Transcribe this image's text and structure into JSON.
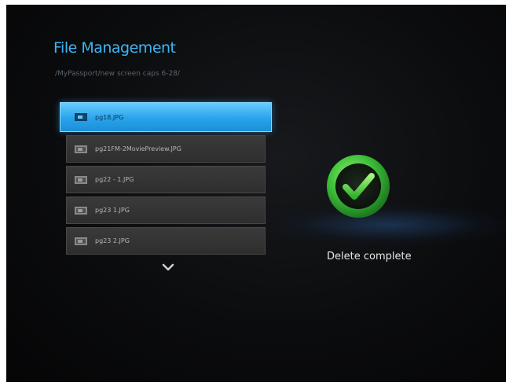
{
  "header": {
    "title": "File Management",
    "path": "/MyPassport/new screen caps 6-28/"
  },
  "file_list": {
    "items": [
      {
        "label": "pg18.JPG",
        "selected": true
      },
      {
        "label": "pg21FM-2MoviePreview.JPG",
        "selected": false
      },
      {
        "label": "pg22 - 1.JPG",
        "selected": false
      },
      {
        "label": "pg23 1.JPG",
        "selected": false
      },
      {
        "label": "pg23 2.JPG",
        "selected": false
      }
    ],
    "more_icon": "chevron-down-icon"
  },
  "status": {
    "icon": "success-check-icon",
    "message": "Delete complete"
  },
  "colors": {
    "accent": "#3fb4f0",
    "selection": "#2aa3ea",
    "success": "#3ec03a"
  }
}
